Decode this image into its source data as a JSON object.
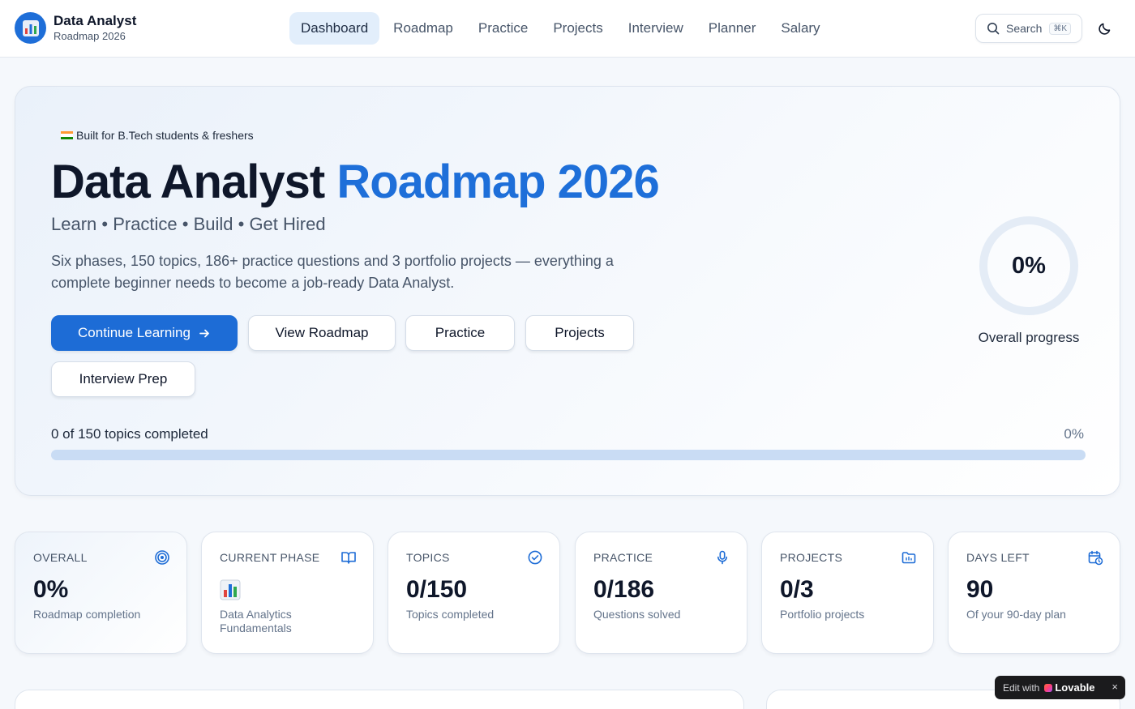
{
  "brand": {
    "title": "Data Analyst",
    "subtitle": "Roadmap 2026"
  },
  "nav": {
    "items": [
      {
        "label": "Dashboard",
        "active": true
      },
      {
        "label": "Roadmap",
        "active": false
      },
      {
        "label": "Practice",
        "active": false
      },
      {
        "label": "Projects",
        "active": false
      },
      {
        "label": "Interview",
        "active": false
      },
      {
        "label": "Planner",
        "active": false
      },
      {
        "label": "Salary",
        "active": false
      }
    ]
  },
  "search": {
    "label": "Search",
    "shortcut": "⌘K"
  },
  "hero": {
    "badge": "Built for B.Tech students & freshers",
    "title_main": "Data Analyst ",
    "title_accent": "Roadmap 2026",
    "tagline": "Learn • Practice • Build • Get Hired",
    "description": "Six phases, 150 topics, 186+ practice questions and 3 portfolio projects — everything a complete beginner needs to become a job-ready Data Analyst.",
    "buttons": {
      "continue": "Continue Learning",
      "roadmap": "View Roadmap",
      "practice": "Practice",
      "projects": "Projects",
      "interview": "Interview Prep"
    },
    "ring": {
      "value": "0%",
      "label": "Overall progress",
      "fraction": 0
    },
    "progress": {
      "label": "0 of 150 topics completed",
      "percent_text": "0%",
      "fraction": 0
    }
  },
  "stats": {
    "overall": {
      "label": "OVERALL",
      "value": "0%",
      "sub": "Roadmap completion",
      "icon": "target-icon"
    },
    "phase": {
      "label": "CURRENT PHASE",
      "sub": "Data Analytics Fundamentals",
      "icon": "book-open-icon",
      "emoji": "bar-chart-emoji"
    },
    "topics": {
      "label": "TOPICS",
      "value": "0/150",
      "sub": "Topics completed",
      "icon": "check-circle-icon"
    },
    "practice": {
      "label": "PRACTICE",
      "value": "0/186",
      "sub": "Questions solved",
      "icon": "microphone-icon"
    },
    "projects": {
      "label": "PROJECTS",
      "value": "0/3",
      "sub": "Portfolio projects",
      "icon": "folder-icon"
    },
    "days": {
      "label": "DAYS LEFT",
      "value": "90",
      "sub": "Of your 90-day plan",
      "icon": "calendar-clock-icon"
    }
  },
  "lovable": {
    "prefix": "Edit with",
    "brand": "Lovable",
    "close": "×"
  },
  "colors": {
    "accent": "#1d6cd6",
    "accent_light": "#c9dcf4",
    "text": "#0f172a",
    "muted": "#64748b"
  }
}
